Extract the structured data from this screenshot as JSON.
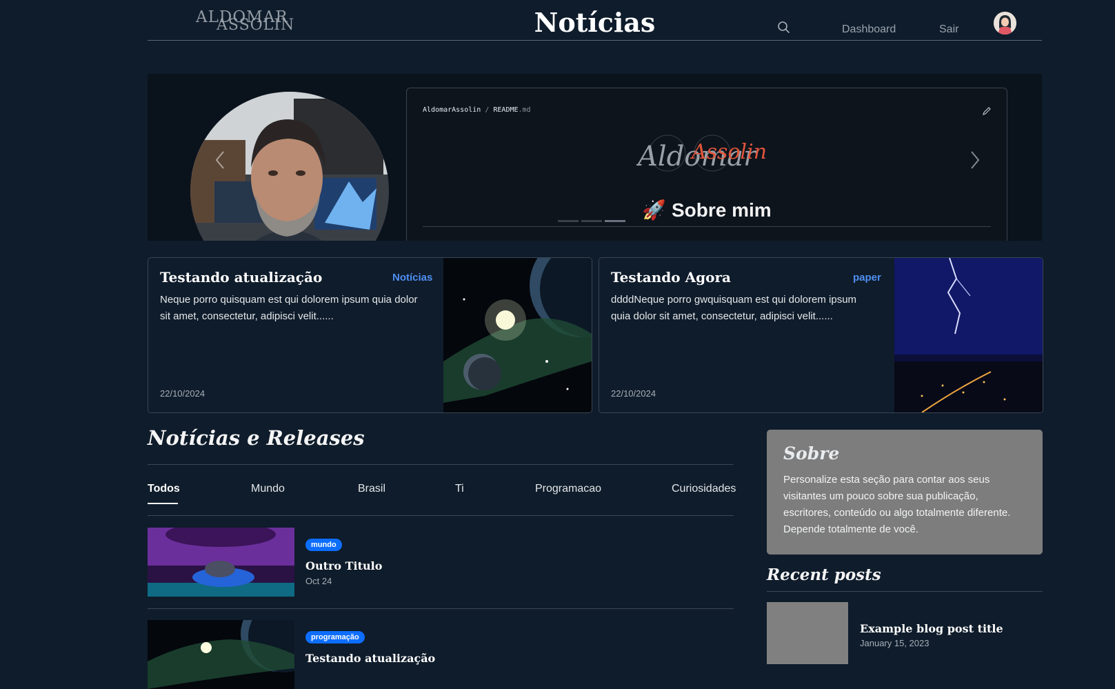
{
  "header": {
    "logo_line1": "ALDOMAR",
    "logo_line2": "ASSOLIN",
    "brand": "Notícias",
    "nav": {
      "dashboard": "Dashboard",
      "logout": "Sair"
    }
  },
  "hero": {
    "readme": {
      "owner": "AldomarAssolin",
      "separator": "/",
      "file": "README",
      "ext": ".md"
    },
    "signature": {
      "part1": "Aldomar",
      "part2": "Assolin",
      "accent_color": "#e2553b"
    },
    "about_emoji": "🚀",
    "about_heading": "Sobre mim"
  },
  "featured": [
    {
      "title": "Testando atualização",
      "category": "Notícias",
      "excerpt": "Neque porro quisquam est qui dolorem ipsum quia dolor sit amet, consectetur, adipisci velit......",
      "date": "22/10/2024"
    },
    {
      "title": "Testando Agora",
      "category": "paper",
      "excerpt": "ddddNeque porro gwquisquam est qui dolorem ipsum quia dolor sit amet, consectetur, adipisci velit......",
      "date": "22/10/2024"
    }
  ],
  "news": {
    "title": "Notícias e Releases",
    "tabs": [
      "Todos",
      "Mundo",
      "Brasil",
      "Ti",
      "Programacao",
      "Curiosidades"
    ],
    "active_tab": "Todos",
    "posts": [
      {
        "badge": "mundo",
        "title": "Outro Titulo",
        "date": "Oct 24"
      },
      {
        "badge": "programação",
        "title": "Testando atualização",
        "date": ""
      }
    ]
  },
  "sidebar": {
    "about_title": "Sobre",
    "about_text": "Personalize esta seção para contar aos seus visitantes um pouco sobre sua publicação, escritores, conteúdo ou algo totalmente diferente. Depende totalmente de você.",
    "recent_title": "Recent posts",
    "recent": [
      {
        "title": "Example blog post title",
        "date": "January 15, 2023"
      }
    ]
  },
  "colors": {
    "page_bg": "#0f1c2b",
    "accent": "#4f8ff2",
    "badge": "#0d6efd",
    "about_box": "#7d7d7d"
  },
  "icons": {
    "search": "search-icon",
    "edit": "pencil-icon",
    "prev": "chevron-left-icon",
    "next": "chevron-right-icon"
  }
}
